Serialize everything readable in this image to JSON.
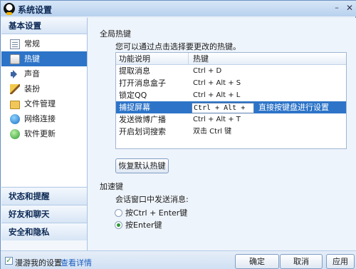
{
  "window": {
    "title": "系统设置"
  },
  "nav": {
    "header": "基本设置",
    "items": [
      {
        "label": "常规",
        "icon": "document-icon"
      },
      {
        "label": "热键",
        "icon": "keyboard-icon",
        "selected": true
      },
      {
        "label": "声音",
        "icon": "speaker-icon"
      },
      {
        "label": "装扮",
        "icon": "brush-icon"
      },
      {
        "label": "文件管理",
        "icon": "folder-icon"
      },
      {
        "label": "网络连接",
        "icon": "network-icon"
      },
      {
        "label": "软件更新",
        "icon": "update-icon"
      }
    ],
    "groups": [
      "状态和提醒",
      "好友和聊天",
      "安全和隐私"
    ]
  },
  "global_hotkeys": {
    "title": "全局热键",
    "description": "您可以通过点击选择要更改的热键。",
    "columns": [
      "功能说明",
      "热键"
    ],
    "rows": [
      {
        "function": "提取消息",
        "hotkey": "Ctrl + D"
      },
      {
        "function": "打开消息盒子",
        "hotkey": "Ctrl + Alt + S"
      },
      {
        "function": "锁定QQ",
        "hotkey": "Ctrl + Alt + L"
      },
      {
        "function": "捕捉屏幕",
        "hotkey": "Ctrl + Alt + ",
        "hint": "直接按键盘进行设置",
        "selected": true
      },
      {
        "function": "发送微博广播",
        "hotkey": "Ctrl + Alt + T"
      },
      {
        "function": "开启划词搜索",
        "hotkey": "双击 Ctrl 键"
      }
    ],
    "restore_label": "恢复默认热键"
  },
  "accel": {
    "title": "加速键",
    "subtitle": "会话窗口中发送消息:",
    "options": [
      {
        "label": "按Ctrl + Enter键",
        "selected": false
      },
      {
        "label": "按Enter键",
        "selected": true
      }
    ]
  },
  "footer": {
    "roam_label": "漫游我的设置",
    "detail_link": "查看详情",
    "ok": "确定",
    "cancel": "取消",
    "apply": "应用"
  },
  "colors": {
    "selection": "#2d74c8",
    "accent_green": "#2e9a33"
  }
}
